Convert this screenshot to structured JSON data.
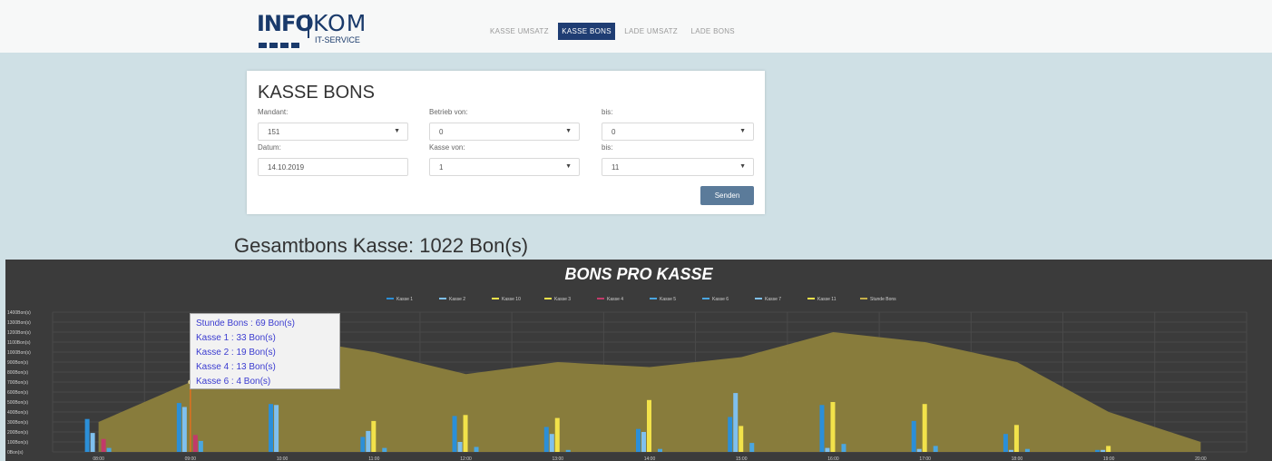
{
  "logo": {
    "part1": "INFO",
    "part2": "KOM",
    "sub": "IT-SERVICE"
  },
  "nav": [
    "KASSE UMSATZ",
    "KASSE BONS",
    "LADE UMSATZ",
    "LADE BONS"
  ],
  "nav_active": "KASSE BONS",
  "form": {
    "title": "KASSE BONS",
    "mandant_label": "Mandant:",
    "mandant_value": "151",
    "betrieb_von_label": "Betrieb von:",
    "betrieb_von_value": "0",
    "betrieb_bis_label": "bis:",
    "betrieb_bis_value": "0",
    "datum_label": "Datum:",
    "datum_value": "14.10.2019",
    "kasse_von_label": "Kasse von:",
    "kasse_von_value": "1",
    "kasse_bis_label": "bis:",
    "kasse_bis_value": "11",
    "send_label": "Senden"
  },
  "summary": "Gesamtbons Kasse: 1022 Bon(s)",
  "tooltip": [
    "Stunde Bons : 69 Bon(s)",
    "Kasse 1 : 33 Bon(s)",
    "Kasse 2 : 19 Bon(s)",
    "Kasse 4 : 13 Bon(s)",
    "Kasse 6 : 4 Bon(s)"
  ],
  "colors": {
    "k1": "#2b8fd8",
    "k2": "#7fc0ee",
    "k3": "#f2e24a",
    "k4": "#c23a6a",
    "area": "#8c7f3c",
    "bg": "#3b3b3b",
    "nav_active": "#1f3d73"
  },
  "chart_data": {
    "type": "bar",
    "title": "BONS PRO KASSE",
    "legend": [
      "Kasse 1",
      "Kasse 2",
      "Kasse 10",
      "Kasse 3",
      "Kasse 4",
      "Kasse 5",
      "Kasse 6",
      "Kasse 7",
      "Kasse 11",
      "Stunde Bons"
    ],
    "y_ticks": [
      "0Bon(s)",
      "100Bon(s)",
      "200Bon(s)",
      "300Bon(s)",
      "400Bon(s)",
      "500Bon(s)",
      "600Bon(s)",
      "700Bon(s)",
      "800Bon(s)",
      "900Bon(s)",
      "1000Bon(s)",
      "1100Bon(s)",
      "1200Bon(s)",
      "1300Bon(s)",
      "1400Bon(s)"
    ],
    "ylim": [
      0,
      1400
    ],
    "hours": [
      "08:00",
      "09:00",
      "10:00",
      "11:00",
      "12:00",
      "13:00",
      "14:00",
      "15:00",
      "16:00",
      "17:00",
      "18:00",
      "19:00",
      "20:00"
    ],
    "stunde_bons": [
      300,
      700,
      1150,
      1000,
      780,
      900,
      850,
      950,
      1200,
      1100,
      900,
      400,
      100
    ],
    "series": [
      {
        "name": "Kasse 1",
        "values": [
          330,
          490,
          480,
          150,
          360,
          250,
          230,
          350,
          470,
          310,
          180,
          20,
          0
        ],
        "color": "#2b8fd8"
      },
      {
        "name": "Kasse 2",
        "values": [
          190,
          450,
          470,
          210,
          100,
          180,
          200,
          590,
          40,
          30,
          20,
          20,
          0
        ],
        "color": "#7fc0ee"
      },
      {
        "name": "Kasse 3",
        "values": [
          0,
          0,
          0,
          310,
          370,
          340,
          520,
          260,
          500,
          480,
          270,
          60,
          0
        ],
        "color": "#f2e24a"
      },
      {
        "name": "Kasse 4",
        "values": [
          130,
          170,
          0,
          0,
          0,
          0,
          0,
          0,
          0,
          0,
          0,
          0,
          0
        ],
        "color": "#c23a6a"
      },
      {
        "name": "Kasse 6",
        "values": [
          40,
          110,
          0,
          40,
          50,
          20,
          30,
          90,
          80,
          60,
          30,
          0,
          0
        ],
        "color": "#4aa6e0"
      }
    ]
  }
}
